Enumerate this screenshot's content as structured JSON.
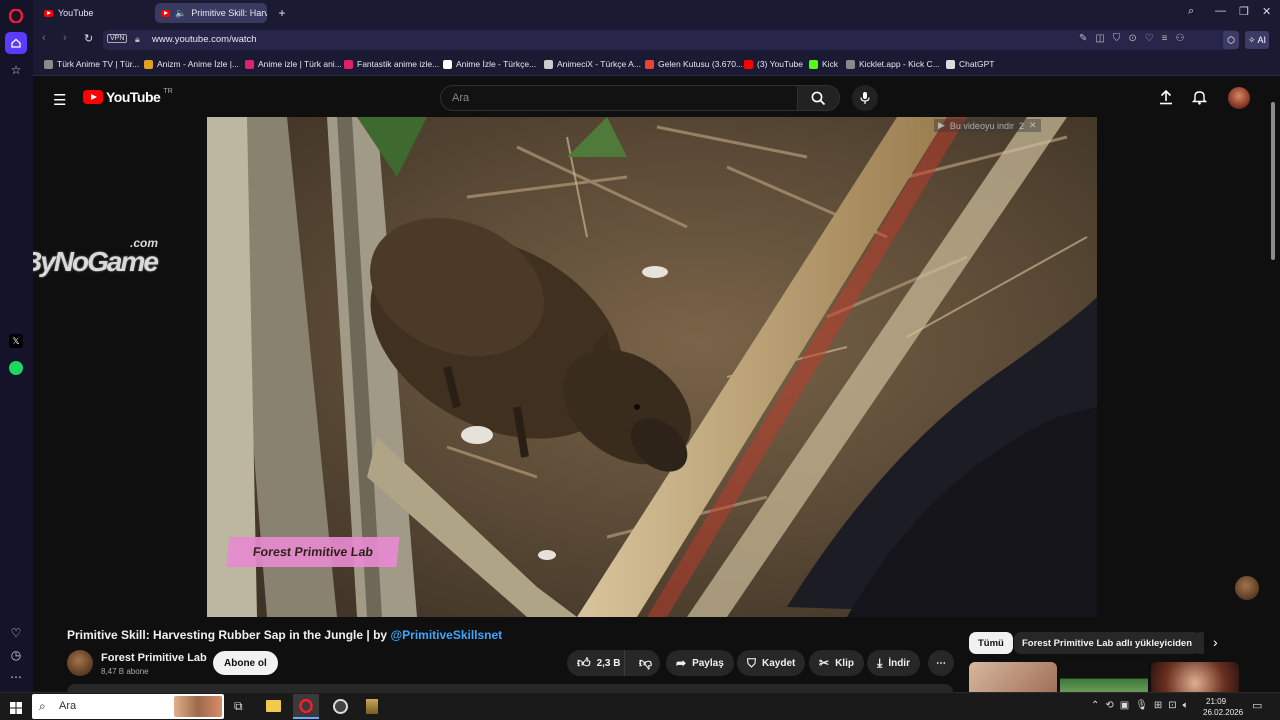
{
  "browser": {
    "tabs": [
      {
        "label": "YouTube"
      },
      {
        "label": "Primitive Skill: Harvest"
      }
    ],
    "address": "www.youtube.com/watch",
    "vpn": "VPN",
    "ai_label": "AI",
    "bookmarks": [
      {
        "label": "Türk Anime TV | Tür...",
        "color": "#8a8a8a"
      },
      {
        "label": "Anizm - Anime İzle |...",
        "color": "#e0a020"
      },
      {
        "label": "Anime izle | Türk ani...",
        "color": "#e0206a"
      },
      {
        "label": "Fantastik anime izle...",
        "color": "#e0206a"
      },
      {
        "label": "Anime İzle - Türkçe...",
        "color": "#ffffff"
      },
      {
        "label": "AnimeciX - Türkçe A...",
        "color": "#cccccc"
      },
      {
        "label": "Gelen Kutusu (3.670...",
        "color": "#ea4335"
      },
      {
        "label": "(3) YouTube",
        "color": "#ff0000"
      },
      {
        "label": "Kick",
        "color": "#53fc18"
      },
      {
        "label": "Kicklet.app - Kick C...",
        "color": "#8a8a8a"
      },
      {
        "label": "ChatGPT",
        "color": "#dddddd"
      }
    ]
  },
  "youtube": {
    "logo": "YouTube",
    "region": "TR",
    "search_placeholder": "Ara",
    "video": {
      "overlay_label": "Forest Primitive Lab",
      "download_hint": "Bu videoyu indir",
      "download_count": "2"
    },
    "side_watermark": {
      "text": "ByNoGame",
      "suffix": ".com"
    },
    "title_prefix": "Primitive Skill: Harvesting Rubber Sap in the Jungle | by ",
    "title_link": "@PrimitiveSkillsnet",
    "channel": {
      "name": "Forest Primitive Lab",
      "subs": "8,47 B abone"
    },
    "subscribe": "Abone ol",
    "actions": {
      "likes": "2,3 B",
      "share": "Paylaş",
      "save": "Kaydet",
      "clip": "Klip",
      "download": "İndir"
    },
    "chips": [
      "Tümü",
      "Forest Primitive Lab adlı yükleyiciden"
    ]
  },
  "taskbar": {
    "search": "Ara",
    "time": "21:09",
    "date": "26.02.2026"
  }
}
